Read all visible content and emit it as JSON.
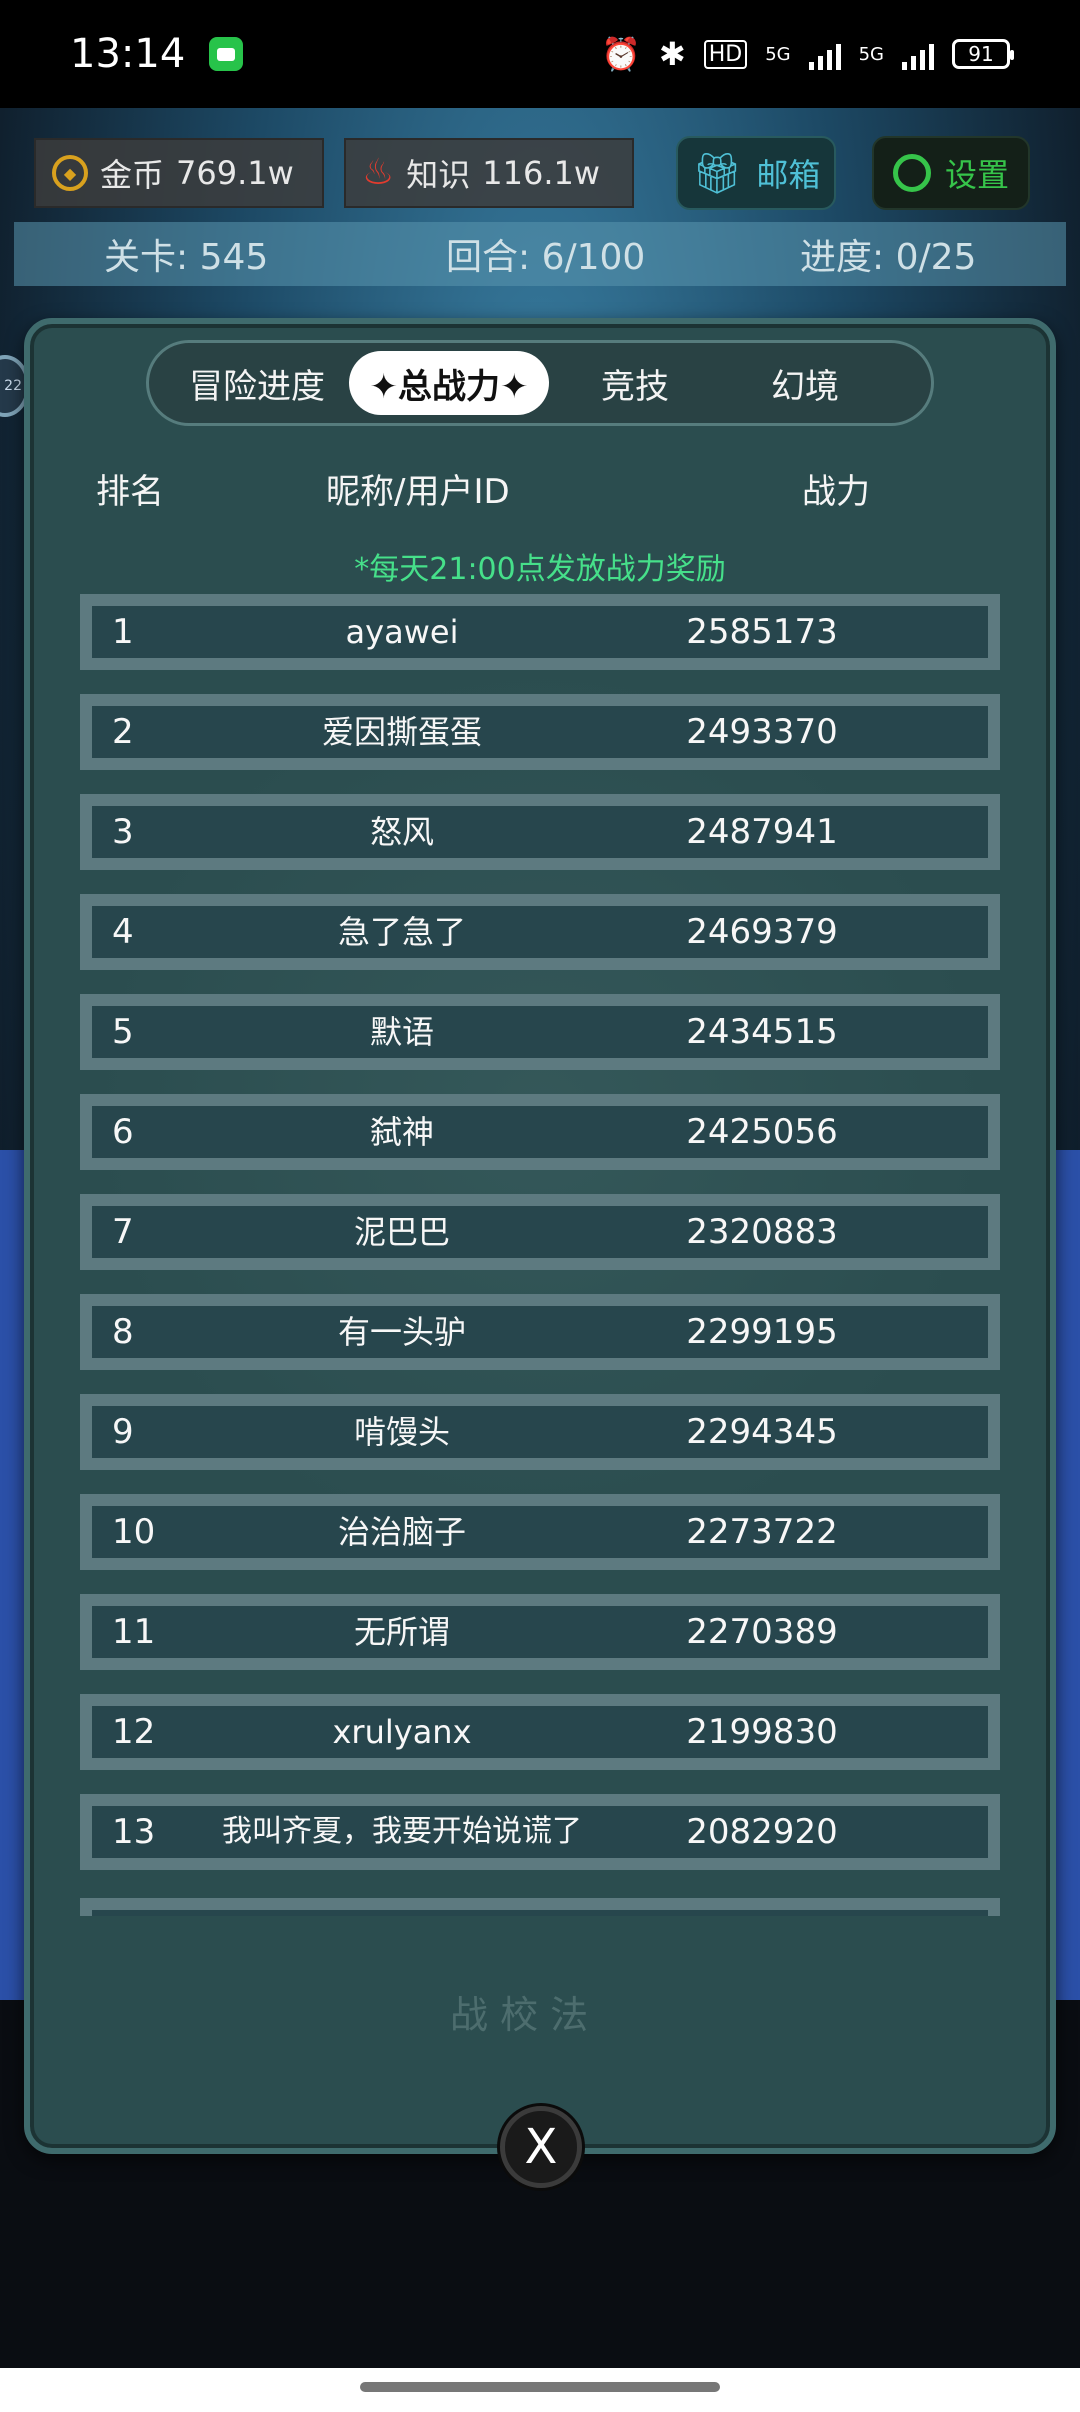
{
  "status_bar": {
    "time": "13:14",
    "network_1": "5G",
    "network_2": "5G",
    "hd_badge": "HD",
    "battery": "91",
    "icons": [
      "message-app-icon",
      "alarm-icon",
      "bluetooth-icon",
      "hd-voice-icon",
      "signal-icon",
      "battery-icon"
    ]
  },
  "hud": {
    "gold_label": "金币",
    "gold_value": "769.1w",
    "knowledge_label": "知识",
    "knowledge_value": "116.1w",
    "mail_label": "邮箱",
    "settings_label": "设置"
  },
  "level_bar": {
    "stage": "关卡: 545",
    "round": "回合: 6/100",
    "progress": "进度: 0/25"
  },
  "side_badge": "22",
  "tabs": [
    {
      "label": "冒险进度",
      "active": false
    },
    {
      "label": "✦总战力✦",
      "active": true
    },
    {
      "label": "竞技",
      "active": false
    },
    {
      "label": "幻境",
      "active": false
    }
  ],
  "columns": {
    "rank": "排名",
    "name": "昵称/用户ID",
    "power": "战力"
  },
  "notice": "*每天21:00点发放战力奖励",
  "rankings": [
    {
      "rank": "1",
      "name": "ayawei",
      "power": "2585173"
    },
    {
      "rank": "2",
      "name": "爱因撕蛋蛋",
      "power": "2493370"
    },
    {
      "rank": "3",
      "name": "怒风",
      "power": "2487941"
    },
    {
      "rank": "4",
      "name": "急了急了",
      "power": "2469379"
    },
    {
      "rank": "5",
      "name": "默语",
      "power": "2434515"
    },
    {
      "rank": "6",
      "name": "弑神",
      "power": "2425056"
    },
    {
      "rank": "7",
      "name": "泥巴巴",
      "power": "2320883"
    },
    {
      "rank": "8",
      "name": "有一头驴",
      "power": "2299195"
    },
    {
      "rank": "9",
      "name": "啃馒头",
      "power": "2294345"
    },
    {
      "rank": "10",
      "name": "治治脑子",
      "power": "2273722"
    },
    {
      "rank": "11",
      "name": "无所谓",
      "power": "2270389"
    },
    {
      "rank": "12",
      "name": "xrulyanx",
      "power": "2199830"
    },
    {
      "rank": "13",
      "name": "我叫齐夏，我要开始说谎了",
      "power": "2082920"
    }
  ],
  "watermark": "战 校 法",
  "close_label": "X",
  "colors": {
    "notice": "#46e08a",
    "mail": "#4fc0d6",
    "settings": "#36c44a",
    "gold": "#d9a11e",
    "flame": "#e23b2e"
  }
}
